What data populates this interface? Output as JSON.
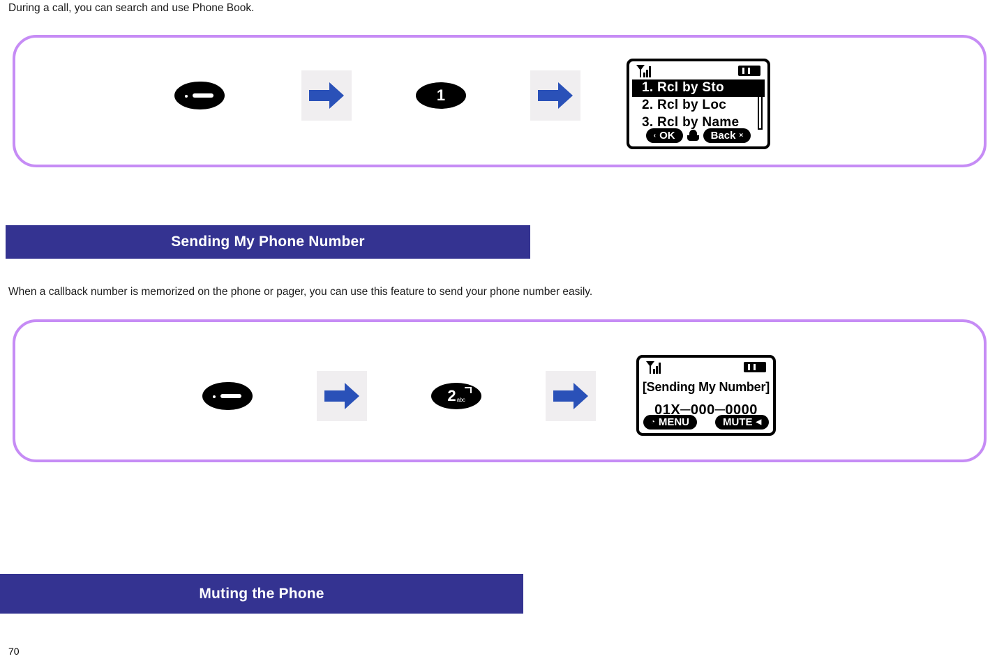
{
  "page": {
    "number": "70",
    "intro_text": "During a call, you can search and use Phone Book.",
    "callback_text": "When a callback number is memorized on the phone or pager, you can use this feature to send your phone number easily."
  },
  "colors": {
    "section_bar_bg": "#343391",
    "section_bar_text": "#ffffff",
    "step_box_border": "#c68cf5",
    "arrow_blue": "#2a51b8",
    "arrow_tile_bg": "#f0eef0"
  },
  "sections": [
    {
      "label": "Sending My Phone Number"
    },
    {
      "label": "Muting the Phone"
    }
  ],
  "step_flows": [
    {
      "name": "phone-book-search-flow",
      "steps": [
        {
          "type": "key-send",
          "icon": "send-key-icon",
          "label": ""
        },
        {
          "type": "arrow",
          "icon": "right-arrow-icon"
        },
        {
          "type": "key-num",
          "icon": "keypad-1-icon",
          "digit": "1",
          "letters": ""
        },
        {
          "type": "arrow",
          "icon": "right-arrow-icon"
        }
      ],
      "screen": {
        "type": "menu",
        "status": {
          "signal_icon": "signal-bars-icon",
          "battery_icon": "battery-icon"
        },
        "menu_items": [
          {
            "text": "1. Rcl by Sto",
            "selected": true
          },
          {
            "text": "2. Rcl by Loc",
            "selected": false
          },
          {
            "text": "3. Rcl by Name",
            "selected": false
          }
        ],
        "softkeys": [
          {
            "label": "OK",
            "left_glyph": "‹",
            "right_glyph": ""
          },
          {
            "label": "Back",
            "left_glyph": "",
            "right_glyph": "×"
          }
        ],
        "middle_icon": "menu-key-icon"
      }
    },
    {
      "name": "sending-my-number-flow",
      "steps": [
        {
          "type": "key-send",
          "icon": "send-key-icon",
          "label": ""
        },
        {
          "type": "arrow",
          "icon": "right-arrow-icon"
        },
        {
          "type": "key-num",
          "icon": "keypad-2-icon",
          "digit": "2",
          "letters": "abc"
        },
        {
          "type": "arrow",
          "icon": "right-arrow-icon"
        }
      ],
      "screen": {
        "type": "info",
        "status": {
          "signal_icon": "signal-bars-icon",
          "battery_icon": "battery-icon"
        },
        "title": "[Sending My Number]",
        "number": "01X─000─0000",
        "softkeys": [
          {
            "label": "MENU",
            "left_glyph": "◔",
            "right_glyph": ""
          },
          {
            "label": "MUTE",
            "left_glyph": "",
            "right_glyph": "◀"
          }
        ]
      }
    }
  ]
}
